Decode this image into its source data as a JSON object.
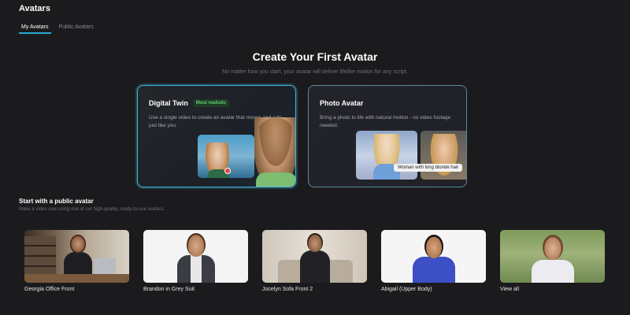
{
  "header": {
    "title": "Avatars"
  },
  "tabs": [
    {
      "label": "My Avatars",
      "active": true
    },
    {
      "label": "Public Avatars",
      "active": false
    }
  ],
  "hero": {
    "title": "Create Your First Avatar",
    "subtitle": "No matter how you start, your avatar will deliver lifelike motion for any script."
  },
  "cards": {
    "digital_twin": {
      "title": "Digital Twin",
      "badge": "Most realistic",
      "description": "Use a single video to create an avatar that moves and acts just like you."
    },
    "photo_avatar": {
      "title": "Photo Avatar",
      "description": "Bring a photo to life with natural motion - no video footage needed.",
      "prompt_chip": "Woman with long blonde hair"
    }
  },
  "public_section": {
    "title": "Start with a public avatar",
    "subtitle": "Make a video now using one of our high-quality, ready-to-use avatars."
  },
  "avatars": [
    {
      "label": "Georgia Office Front"
    },
    {
      "label": "Brandon in Grey Suit"
    },
    {
      "label": "Jocelyn Sofa Front 2"
    },
    {
      "label": "Abigail (Upper Body)"
    },
    {
      "label": "View all"
    }
  ],
  "colors": {
    "background": "#1b1b1e",
    "accent": "#3fb7de",
    "badge_text": "#5fd06f",
    "badge_bg": "#1f3a26"
  }
}
